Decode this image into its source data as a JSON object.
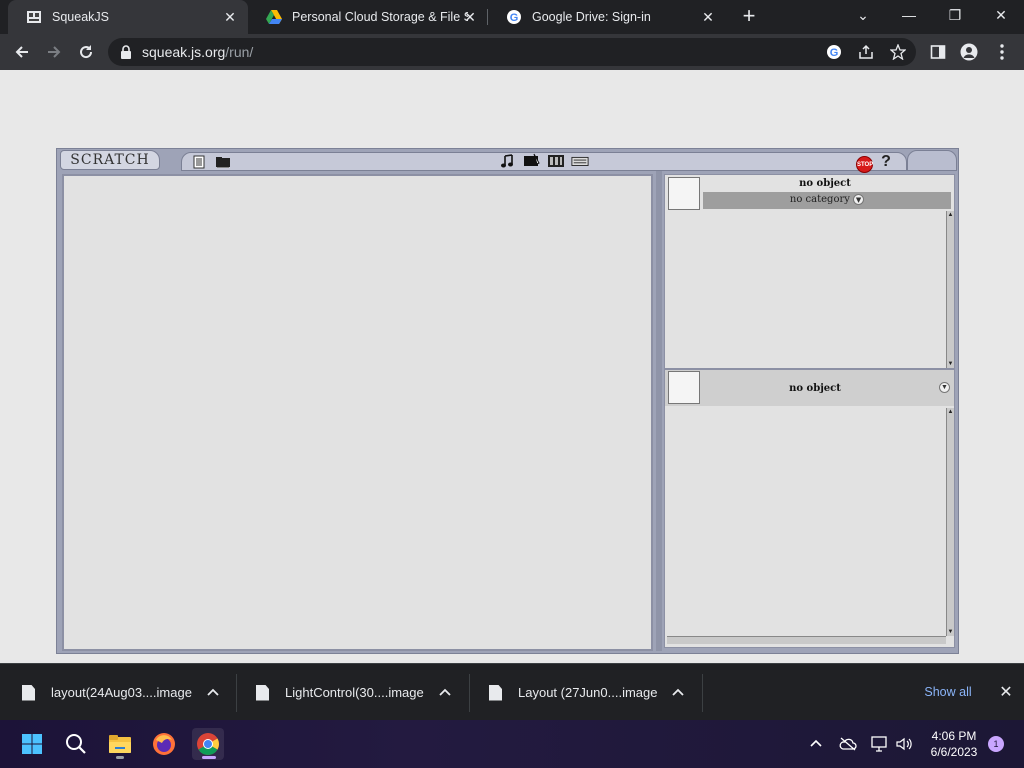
{
  "browser": {
    "tabs": [
      {
        "title": "SqueakJS",
        "active": true,
        "icon": "squeak-favicon"
      },
      {
        "title": "Personal Cloud Storage & File Sh",
        "active": false,
        "icon": "google-drive-icon"
      },
      {
        "title": "Google Drive: Sign-in",
        "active": false,
        "icon": "google-icon"
      }
    ],
    "address": {
      "host": "squeak.js.org",
      "path": "/run/"
    }
  },
  "scratch": {
    "logo": "SCRATCH",
    "stop_label": "STOP",
    "help_label": "?",
    "sprite_pane": {
      "title": "no object",
      "category": "no category"
    },
    "script_pane": {
      "title": "no object"
    }
  },
  "downloads": {
    "items": [
      {
        "name": "layout(24Aug03....image"
      },
      {
        "name": "LightControl(30....image"
      },
      {
        "name": "Layout (27Jun0....image"
      }
    ],
    "show_all": "Show all"
  },
  "taskbar": {
    "time": "4:06 PM",
    "date": "6/6/2023",
    "notification_count": "1"
  },
  "colors": {
    "chrome_dark": "#202124",
    "chrome_toolbar": "#35363a",
    "scratch_frame": "#9ea3b7",
    "link_blue": "#8ab4f8",
    "stop_red": "#d71a1a"
  }
}
